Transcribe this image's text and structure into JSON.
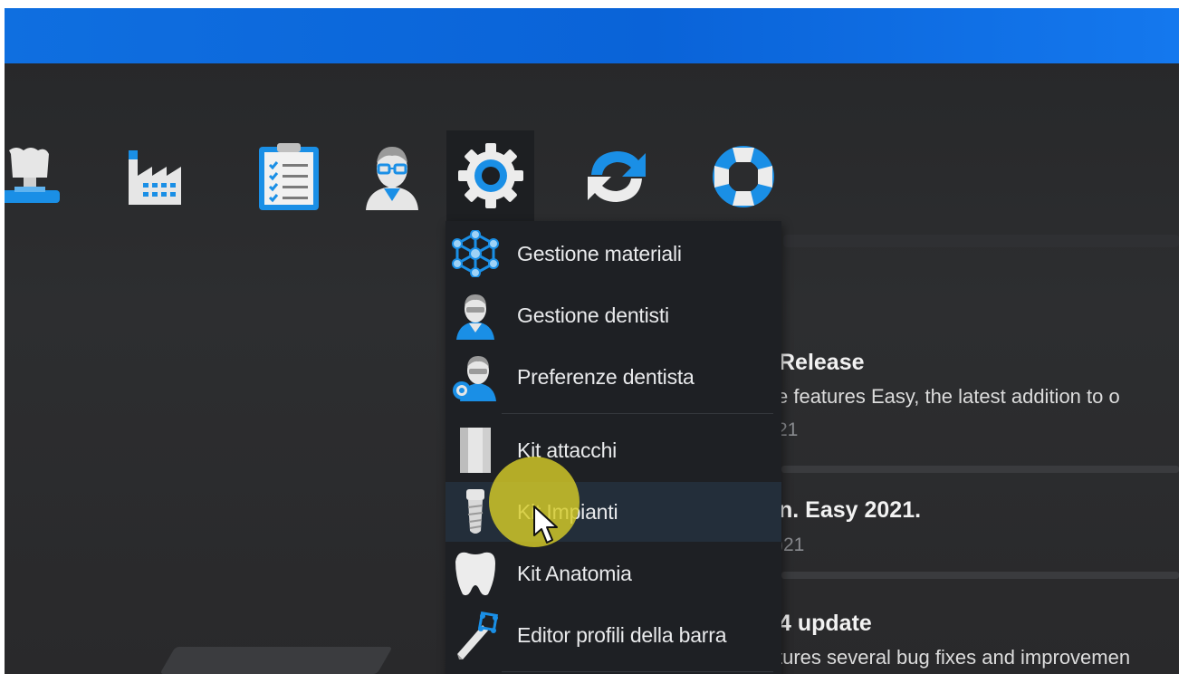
{
  "toolbar": {
    "tools": [
      {
        "icon": "crown-scan-icon"
      },
      {
        "icon": "factory-icon"
      },
      {
        "icon": "clipboard-icon"
      },
      {
        "icon": "dentist-icon"
      },
      {
        "icon": "gear-icon",
        "active": true
      },
      {
        "icon": "sync-icon"
      },
      {
        "icon": "lifebuoy-icon"
      }
    ]
  },
  "menu": {
    "items": [
      {
        "label": "Gestione materiali",
        "icon": "molecule-icon"
      },
      {
        "label": "Gestione dentisti",
        "icon": "dentist-icon"
      },
      {
        "label": "Preferenze dentista",
        "icon": "dentist-settings-icon"
      },
      {
        "label": "Kit attacchi",
        "icon": "attachment-icon"
      },
      {
        "label": "Kit Impianti",
        "icon": "implant-icon",
        "hovered": true
      },
      {
        "label": "Kit Anatomia",
        "icon": "tooth-icon"
      },
      {
        "label": "Editor profili della barra",
        "icon": "bar-editor-icon"
      }
    ]
  },
  "news": [
    {
      "title": "Release",
      "desc": "e features Easy, the latest addition to o",
      "date": "21"
    },
    {
      "title": "n. Easy 2021.",
      "date": ")21"
    },
    {
      "title": "4 update",
      "desc": "tures several bug fixes and improvemen"
    }
  ],
  "colors": {
    "accent_blue": "#1a8fe6",
    "title_bar": "#0a63d8",
    "menu_bg": "#1e2024",
    "cursor_highlight": "#d6cc28"
  }
}
